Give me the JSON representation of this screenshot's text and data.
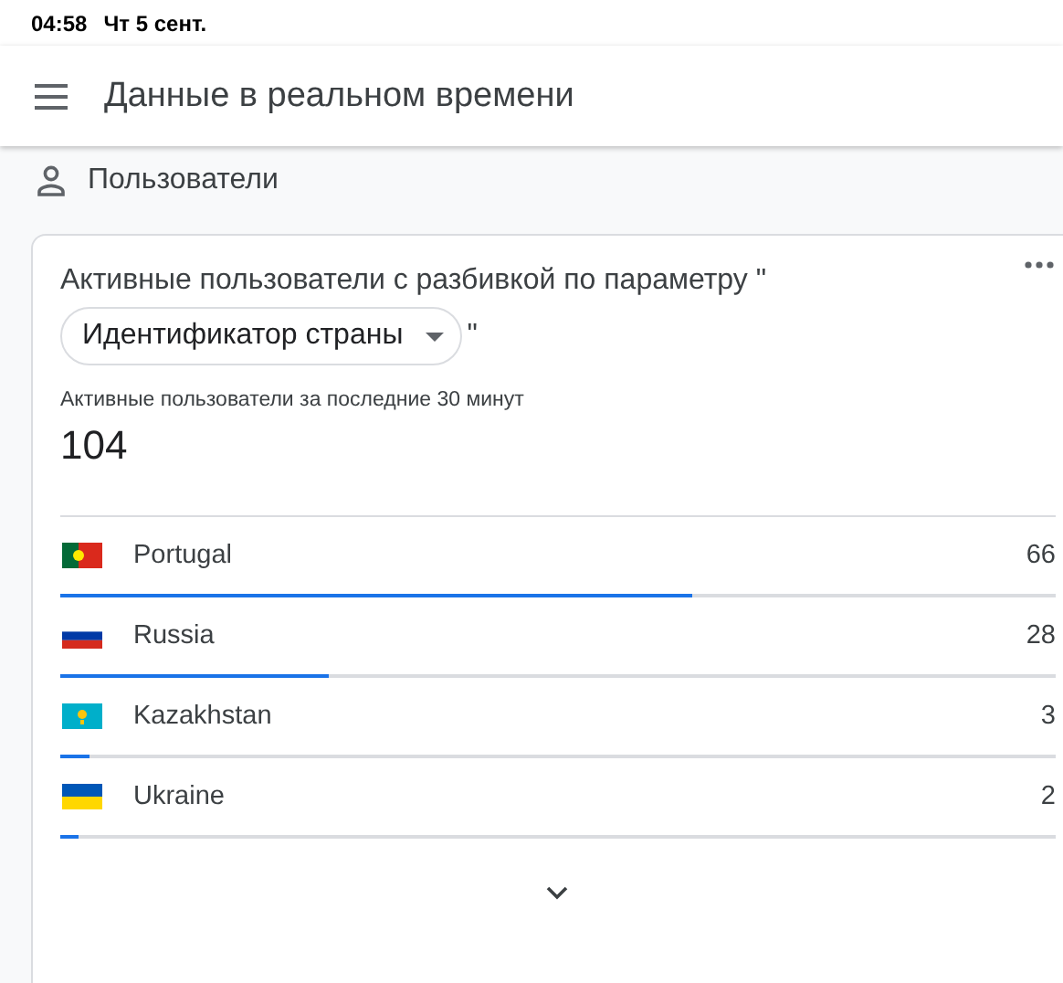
{
  "status_bar": {
    "time": "04:58",
    "date": "Чт 5 сент."
  },
  "app_bar": {
    "title": "Данные в реальном времени"
  },
  "section": {
    "title": "Пользователи"
  },
  "card": {
    "title_before": "Активные пользователи с разбивкой по параметру \"",
    "dimension": "Идентификатор страны",
    "title_after": "\"",
    "metric_label": "Активные пользователи за последние 30 минут",
    "metric_value": "104",
    "rows": [
      {
        "kind": "portugal",
        "country": "Portugal",
        "value": "66",
        "level": 0.635
      },
      {
        "kind": "russia",
        "country": "Russia",
        "value": "28",
        "level": 0.27
      },
      {
        "kind": "kazakhstan",
        "country": "Kazakhstan",
        "value": "3",
        "level": 0.029
      },
      {
        "kind": "ukraine",
        "country": "Ukraine",
        "value": "2",
        "level": 0.019
      }
    ]
  }
}
